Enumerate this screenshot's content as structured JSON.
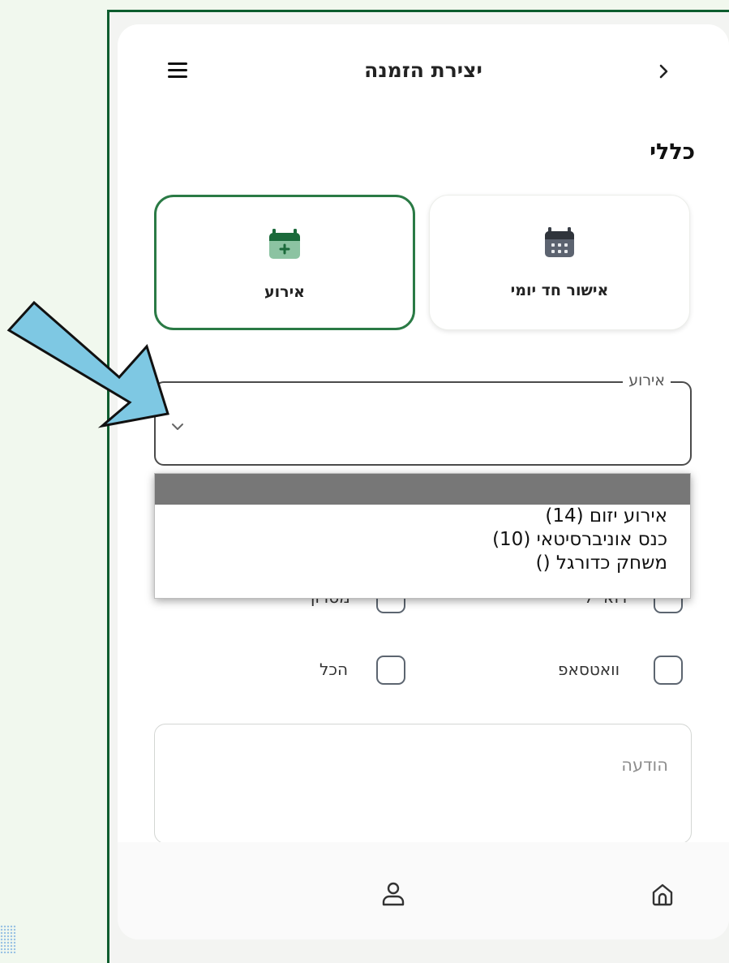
{
  "header": {
    "title": "יצירת הזמנה",
    "menu_icon": "hamburger-menu-icon",
    "back_icon": "chevron-right-icon"
  },
  "section": {
    "title": "כללי"
  },
  "type_cards": [
    {
      "label": "אישור חד יומי",
      "icon": "calendar-icon",
      "selected": false
    },
    {
      "label": "אירוע",
      "icon": "calendar-plus-icon",
      "selected": true
    }
  ],
  "event_select": {
    "label": "אירוע",
    "value": "",
    "options": [
      "",
      "אירוע יזום (14)",
      "כנס אוניברסיטאי (10)",
      "משחק כדורגל ()"
    ]
  },
  "checkboxes": {
    "partial_right_label": "דוא״ל",
    "partial_left_label": "מסרון",
    "whatsapp_label": "וואטסאפ",
    "all_label": "הכל"
  },
  "message": {
    "placeholder": "הודעה",
    "value": ""
  },
  "bottom_nav": [
    {
      "icon": "home-icon"
    },
    {
      "icon": "user-icon"
    }
  ],
  "colors": {
    "accent_green": "#2a7a45",
    "annotation_arrow": "#7ec8e3",
    "frame_green": "#0d5d2e"
  }
}
